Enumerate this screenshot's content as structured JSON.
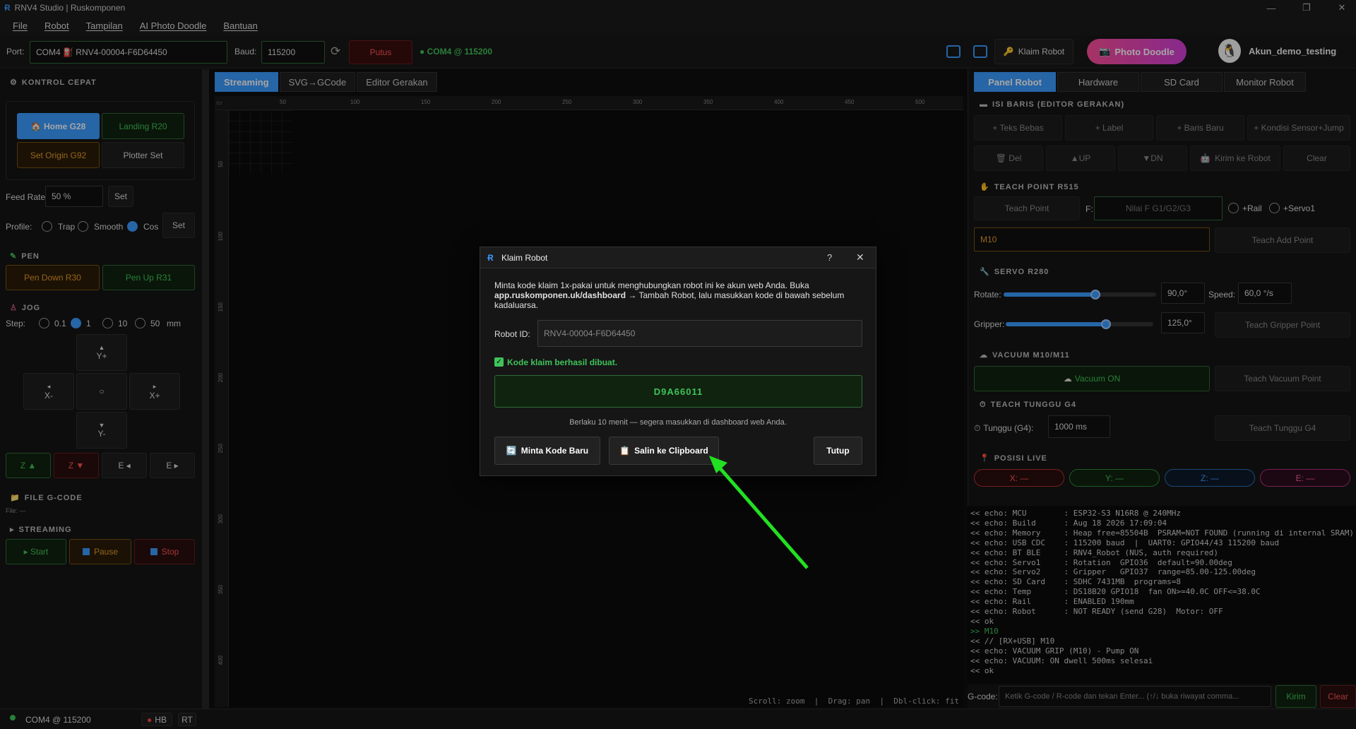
{
  "window": {
    "title": "RNV4 Studio | Ruskomponen",
    "minimize": "—",
    "maximize": "❐",
    "close": "✕"
  },
  "menu": [
    "File",
    "Robot",
    "Tampilan",
    "AI Photo Doodle",
    "Bantuan"
  ],
  "toolbar": {
    "port_label": "Port:",
    "port_value": "COM4  ⛽ RNV4-00004-F6D64450",
    "baud_label": "Baud:",
    "baud_value": "115200",
    "disconnect_label": "Putus",
    "status": "● COM4 @ 115200",
    "claim_label": "Klaim Robot",
    "photo_doodle_label": "Photo Doodle",
    "account_label": "Akun_demo_testing"
  },
  "left": {
    "quick_title": "KONTROL CEPAT",
    "home": "🏠 Home  G28",
    "landing": "Landing  R20",
    "set_origin": "Set Origin  G92",
    "plotter_set": "Plotter Set",
    "feed_label": "Feed Rate:",
    "feed_value": "50 %",
    "feed_set": "Set",
    "profile_label": "Profile:",
    "profiles": [
      "Trap",
      "Smooth",
      "Cos"
    ],
    "profile_set": "Set",
    "pen_title": "PEN",
    "pen_down": "Pen Down  R30",
    "pen_up": "Pen Up  R31",
    "jog_title": "JOG",
    "step_label": "Step:",
    "steps": [
      "0.1",
      "1",
      "10",
      "50"
    ],
    "step_unit": "mm",
    "jog_yplus": "Y+",
    "jog_yminus": "Y-",
    "jog_xminus": "X-",
    "jog_xplus": "X+",
    "jog_center": "○",
    "z_up": "Z ▲",
    "z_down": "Z ▼",
    "e_left": "E ◂",
    "e_right": "E ▸",
    "file_title": "FILE G-CODE",
    "file_value": "File: —",
    "stream_title": "STREAMING",
    "start": "▸ Start",
    "pause": "Pause",
    "stop": "Stop"
  },
  "center": {
    "tabs": [
      "Streaming",
      "SVG→GCode",
      "Editor Gerakan"
    ],
    "ruler_x": [
      "50",
      "100",
      "150",
      "200",
      "250",
      "300",
      "350",
      "400",
      "450",
      "500"
    ],
    "ruler_y": [
      "50",
      "100",
      "150",
      "200",
      "250",
      "300",
      "350",
      "400"
    ],
    "hint": "Scroll: zoom  |  Drag: pan  |  Dbl-click: fit"
  },
  "right": {
    "tabs": [
      "Panel Robot",
      "Hardware",
      "SD Card",
      "Monitor Robot"
    ],
    "isi_title": "ISI BARIS  (EDITOR GERAKAN)",
    "row1": [
      "+ Teks Bebas",
      "+ Label",
      "+ Baris Baru",
      "+ Kondisi Sensor+Jump"
    ],
    "row2": [
      "🗑 Del",
      "▲UP",
      "▼DN",
      "Kirim ke Robot",
      "Clear"
    ],
    "teach_title": "TEACH POINT  R515",
    "teach_point": "Teach Point",
    "f_label": "F:",
    "f_placeholder": "Nilai F G1/G2/G3",
    "rail": "+Rail",
    "servo1": "+Servo1",
    "m10_value": "M10",
    "teach_add": "Teach Add Point",
    "servo_title": "SERVO  R280",
    "rotate_label": "Rotate:",
    "rotate_value": "90,0°",
    "speed_label": "Speed:",
    "speed_value": "60,0 °/s",
    "rotate_level": 0.6,
    "gripper_level": 0.68,
    "gripper_label": "Gripper:",
    "gripper_value": "125,0°",
    "teach_gripper": "Teach Gripper Point",
    "vacuum_title": "VACUUM  M10/M11",
    "vacuum_on": "Vacuum ON",
    "teach_vacuum": "Teach Vacuum Point",
    "wait_title": "TEACH TUNGGU  G4",
    "wait_label": "Tunggu (G4):",
    "wait_value": "1000 ms",
    "teach_wait": "Teach Tunggu G4",
    "live_title": "POSISI LIVE",
    "x": "X: —",
    "y": "Y: —",
    "z": "Z: —",
    "e": "E: —"
  },
  "console": [
    "<< echo: MCU        : ESP32-S3 N16R8 @ 240MHz",
    "<< echo: Build      : Aug 18 2026 17:09:04",
    "<< echo: Memory     : Heap free=85504B  PSRAM=NOT FOUND (running di internal SRAM)",
    "<< echo: USB CDC    : 115200 baud  |  UART0: GPIO44/43 115200 baud",
    "<< echo: BT BLE     : RNV4_Robot (NUS, auth required)",
    "<< echo: Servo1     : Rotation  GPIO36  default=90.00deg",
    "<< echo: Servo2     : Gripper   GPIO37  range=85.00-125.00deg",
    "<< echo: SD Card    : SDHC 7431MB  programs=8",
    "<< echo: Temp       : DS18B20 GPIO18  fan ON>=40.0C OFF<=38.0C",
    "<< echo: Rail       : ENABLED 190mm",
    "<< echo: Robot      : NOT READY (send G28)  Motor: OFF",
    "<< ok",
    ">> M10",
    "<< // [RX+USB] M10",
    "<< echo: VACUUM GRIP (M10) - Pump ON",
    "<< echo: VACUUM: ON dwell 500ms selesai",
    "<< ok"
  ],
  "gcode": {
    "label": "G-code:",
    "placeholder": "Ketik G-code / R-code dan tekan Enter... (↑/↓ buka riwayat comma...",
    "send": "Kirim",
    "clear": "Clear"
  },
  "status": {
    "port": "COM4  @  115200",
    "hb": "HB",
    "rt": "RT"
  },
  "dialog": {
    "title": "Klaim Robot",
    "help": "?",
    "close": "✕",
    "desc1": "Minta kode klaim 1x-pakai untuk menghubungkan robot ini ke akun web Anda. Buka",
    "desc_link": "app.ruskomponen.uk/dashboard",
    "desc2": " → Tambah Robot, lalu masukkan kode di bawah sebelum",
    "desc3": "kadaluarsa.",
    "robot_id_label": "Robot ID:",
    "robot_id_value": "RNV4-00004-F6D64450",
    "success": "Kode klaim berhasil dibuat.",
    "code": "D9A66011",
    "validity": "Berlaku 10 menit — segera masukkan di dashboard web Anda.",
    "new_code": "Minta Kode Baru",
    "copy": "Salin ke Clipboard",
    "close_btn": "Tutup"
  }
}
